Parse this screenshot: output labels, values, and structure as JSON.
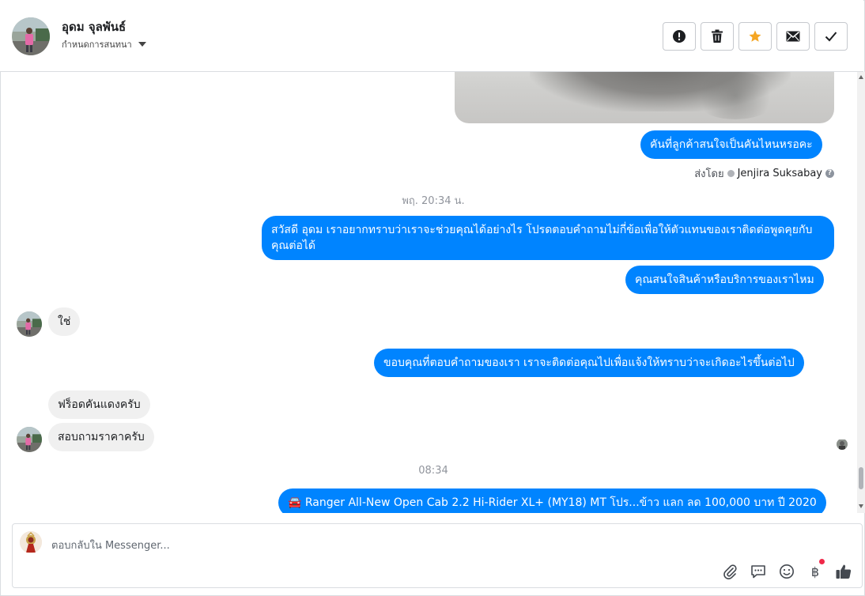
{
  "header": {
    "contact_name": "อุดม จุลพันธ์",
    "assign_label": "กำหนดการสนทนา",
    "actions": [
      {
        "name": "mark-spam-button",
        "icon": "exclamation-circle-icon"
      },
      {
        "name": "delete-button",
        "icon": "trash-icon"
      },
      {
        "name": "star-button",
        "icon": "star-icon"
      },
      {
        "name": "mark-unread-button",
        "icon": "envelope-icon"
      },
      {
        "name": "mark-done-button",
        "icon": "check-icon"
      }
    ]
  },
  "messages": {
    "m1": "คันที่ลูกค้าสนใจเป็นคันไหนหรอคะ",
    "sent_by_prefix": "ส่งโดย",
    "sent_by_agent": "Jenjira Suksabay",
    "ts1": "พฤ. 20:34 น.",
    "m2": "สวัสดี อุดม เราอยากทราบว่าเราจะช่วยคุณได้อย่างไร โปรดตอบคำถามไม่กี่ข้อเพื่อให้ตัวแทนของเราติดต่อพูดคุยกับคุณต่อได้",
    "m3": "คุณสนใจสินค้าหรือบริการของเราไหม",
    "m4": "ใช่",
    "m5": "ขอบคุณที่ตอบคำถามของเรา เราจะติดต่อคุณไปเพื่อแจ้งให้ทราบว่าจะเกิดอะไรขึ้นต่อไป",
    "m6": "ฟร็อดคันแดงครับ",
    "m7": "สอบถามราคาครับ",
    "ts2": "08:34",
    "m8_emoji": "🚘",
    "m8": "Ranger All-New Open Cab 2.2 Hi-Rider XL+ (MY18) MT โปร...ข้าว แลก ลด 100,000 บาท ปี 2020"
  },
  "composer": {
    "placeholder": "ตอบกลับใน Messenger...",
    "icons": [
      "paperclip-icon",
      "saved-reply-icon",
      "emoji-icon",
      "baht-icon",
      "thumbs-up-icon"
    ]
  },
  "colors": {
    "outgoing": "#0084ff",
    "incoming": "#f0f0f0",
    "star": "#f5a623",
    "badge": "#f02849"
  }
}
